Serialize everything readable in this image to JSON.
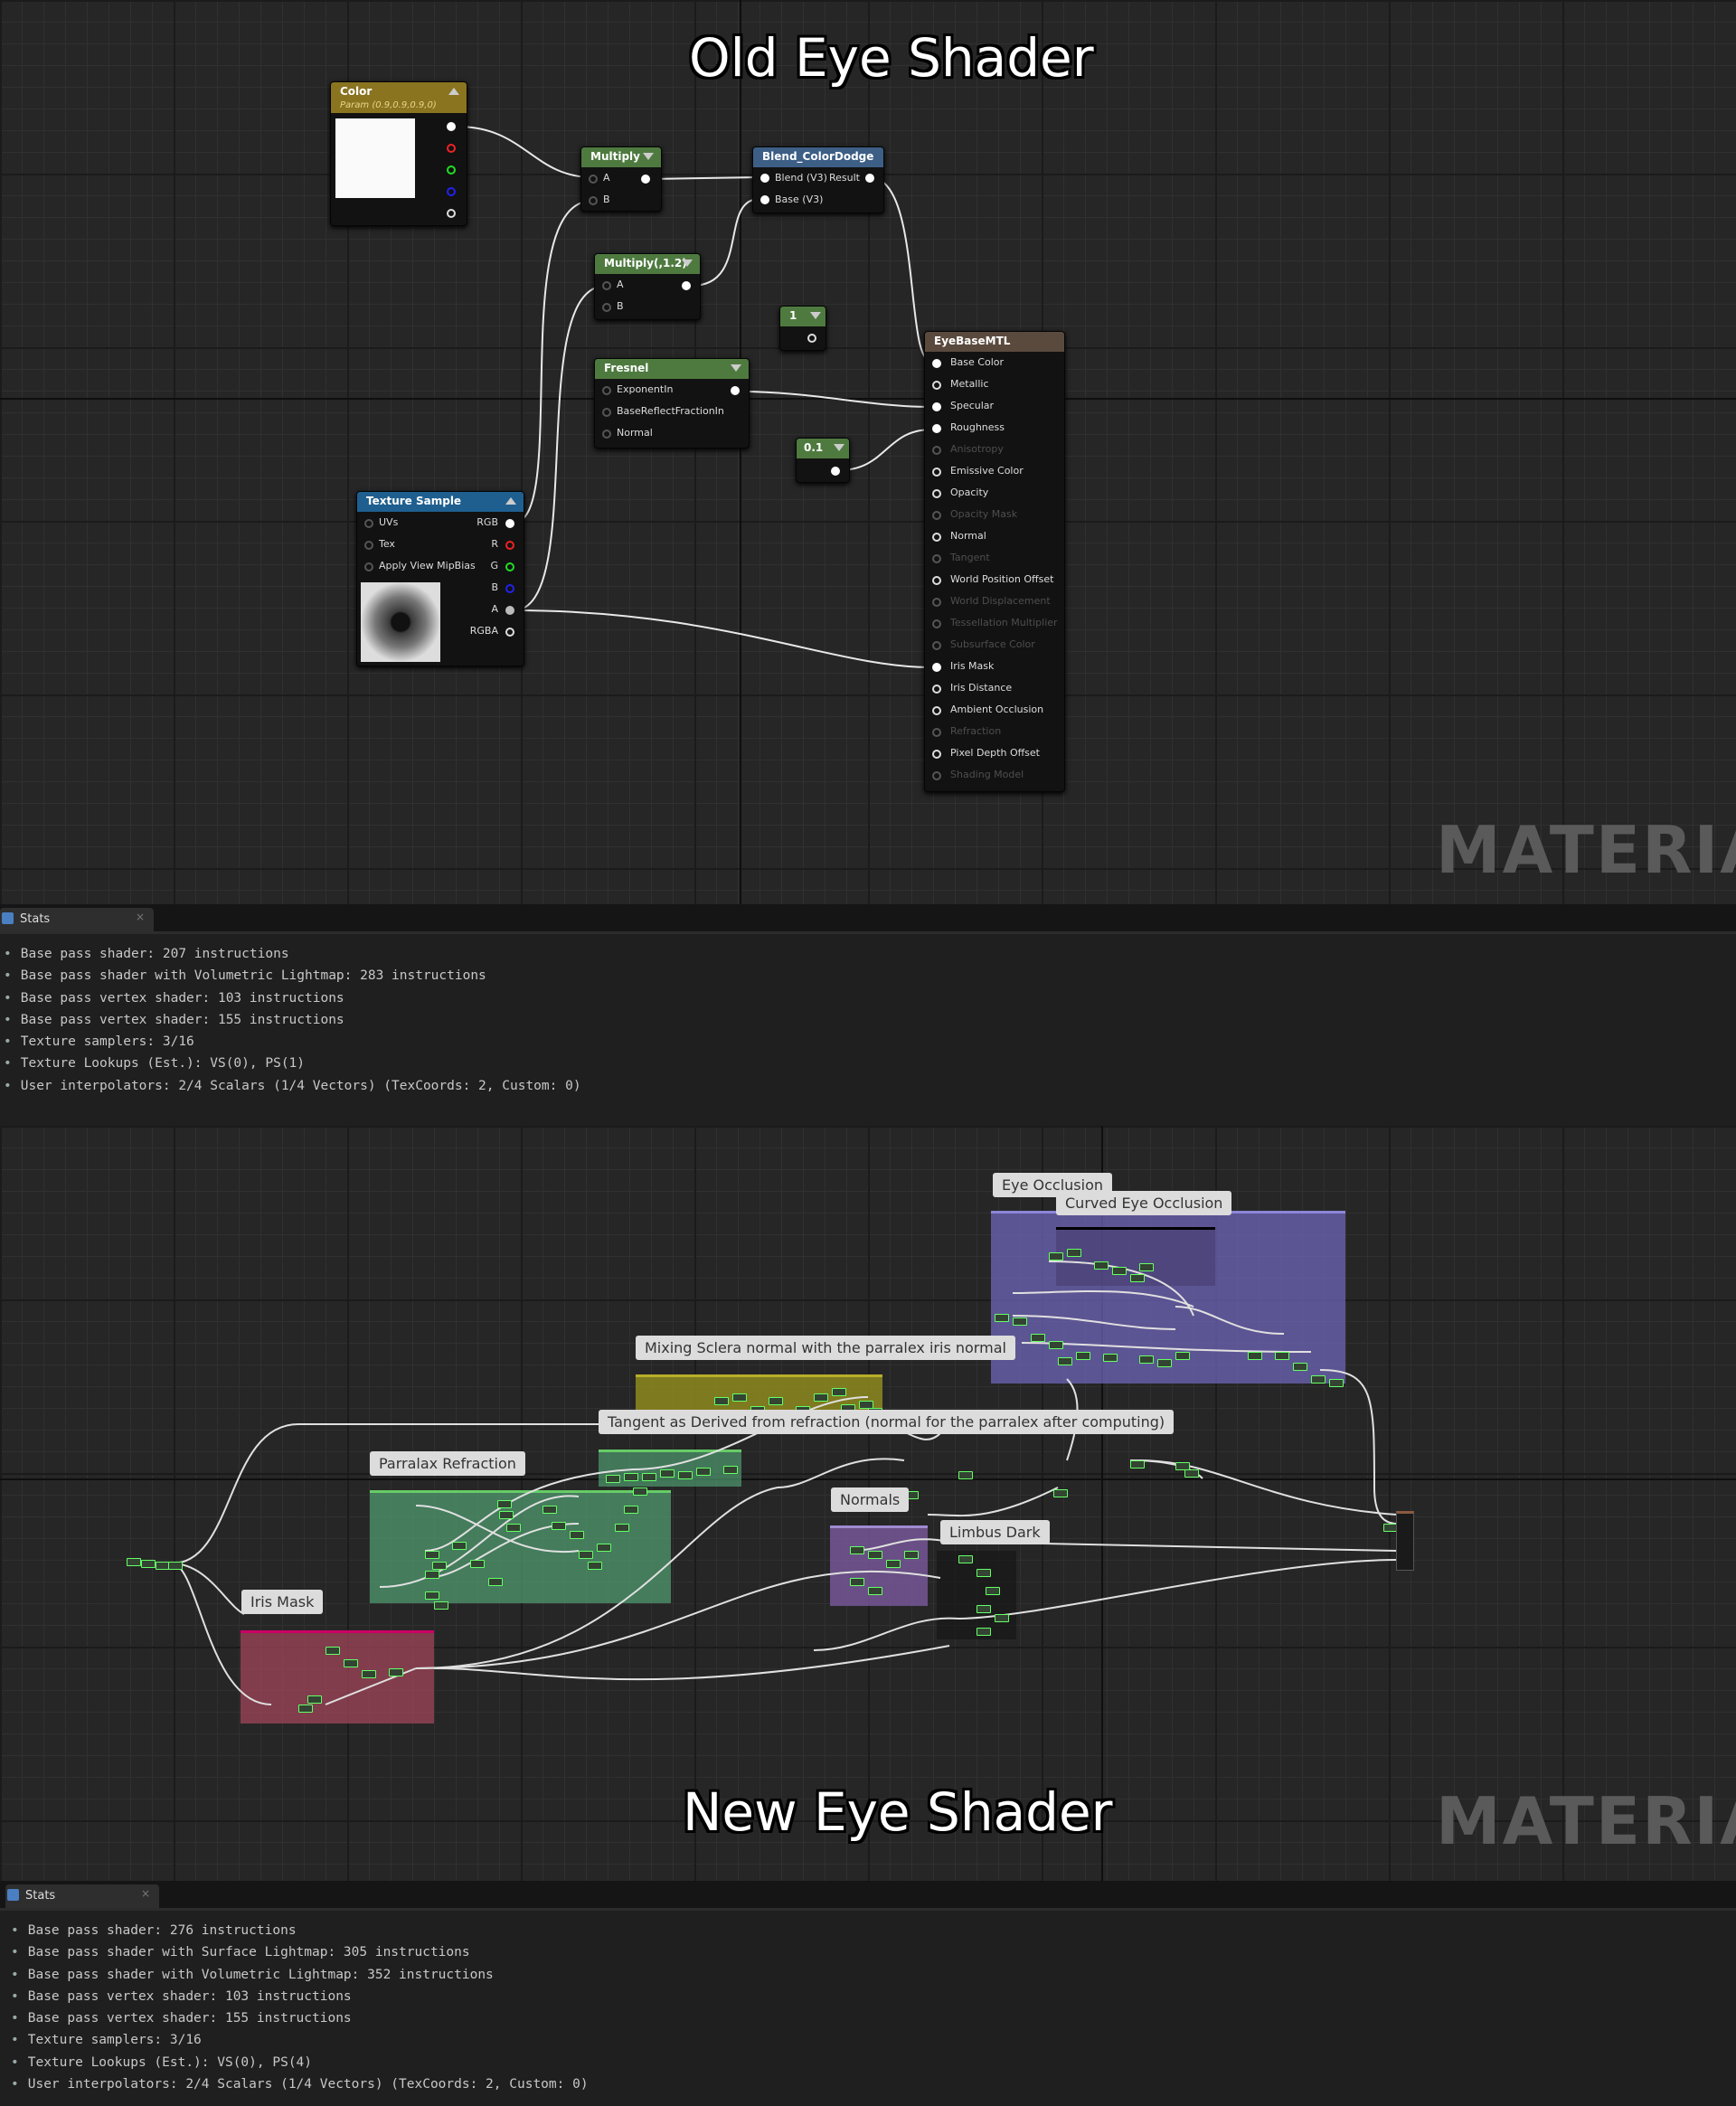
{
  "old_graph": {
    "title": "Old Eye Shader",
    "watermark": "MATERIAL",
    "nodes": {
      "color": {
        "title": "Color",
        "subtitle": "Param (0.9,0.9,0.9,0)"
      },
      "multiply": {
        "title": "Multiply",
        "pins": [
          "A",
          "B"
        ]
      },
      "multiply2": {
        "title": "Multiply(,1.2)",
        "pins": [
          "A",
          "B"
        ]
      },
      "blend": {
        "title": "Blend_ColorDodge",
        "pins": [
          "Blend (V3)",
          "Base (V3)"
        ],
        "output": "Result"
      },
      "const1": {
        "title": "1"
      },
      "fresnel": {
        "title": "Fresnel",
        "pins": [
          "ExponentIn",
          "BaseReflectFractionIn",
          "Normal"
        ]
      },
      "const01": {
        "title": "0.1"
      },
      "texture": {
        "title": "Texture Sample",
        "inputs": [
          "UVs",
          "Tex",
          "Apply View MipBias"
        ],
        "outputs": [
          "RGB",
          "R",
          "G",
          "B",
          "A",
          "RGBA"
        ]
      },
      "eyebase": {
        "title": "EyeBaseMTL",
        "pins": [
          "Base Color",
          "Metallic",
          "Specular",
          "Roughness",
          "Anisotropy",
          "Emissive Color",
          "Opacity",
          "Opacity Mask",
          "Normal",
          "Tangent",
          "World Position Offset",
          "World Displacement",
          "Tessellation Multiplier",
          "Subsurface Color",
          "Iris Mask",
          "Iris Distance",
          "Ambient Occlusion",
          "Refraction",
          "Pixel Depth Offset",
          "Shading Model"
        ]
      }
    }
  },
  "old_stats": {
    "tab_label": "Stats",
    "close": "×",
    "lines": [
      "Base pass shader: 207 instructions",
      "Base pass shader with Volumetric Lightmap: 283 instructions",
      "Base pass vertex shader: 103 instructions",
      "Base pass vertex shader: 155 instructions",
      "Texture samplers: 3/16",
      "Texture Lookups (Est.): VS(0), PS(1)",
      "User interpolators: 2/4 Scalars (1/4 Vectors) (TexCoords: 2, Custom: 0)"
    ]
  },
  "new_graph": {
    "title": "New Eye Shader",
    "watermark": "MATERIAL",
    "comments": {
      "eye_occlusion": "Eye Occlusion",
      "curved_eye_occlusion": "Curved Eye Occlusion",
      "mixing": "Mixing Sclera normal with the parralex iris normal",
      "tangent": "Tangent as Derived from refraction (normal for the parralex after computing)",
      "parallax": "Parralax Refraction",
      "normals": "Normals",
      "limbus": "Limbus Dark",
      "iris_mask": "Iris Mask"
    }
  },
  "new_stats": {
    "tab_label": "Stats",
    "close": "×",
    "lines": [
      "Base pass shader: 276 instructions",
      "Base pass shader with Surface Lightmap: 305 instructions",
      "Base pass shader with Volumetric Lightmap: 352 instructions",
      "Base pass vertex shader: 103 instructions",
      "Base pass vertex shader: 155 instructions",
      "Texture samplers: 3/16",
      "Texture Lookups (Est.): VS(0), PS(4)",
      "User interpolators: 2/4 Scalars (1/4 Vectors) (TexCoords: 2, Custom: 0)"
    ]
  },
  "colors": {
    "param_header": "#8a7420",
    "math_header": "#4e7a3f",
    "blend_header": "#3d5f86",
    "texture_header": "#1f5f8f",
    "material_header": "#5a4a3e",
    "comment_purple": "#6f66b8",
    "comment_yellow": "#8e8a1e",
    "comment_green": "#4f9a6f",
    "comment_red": "#a0465a",
    "comment_violet": "#7a5a9e"
  }
}
